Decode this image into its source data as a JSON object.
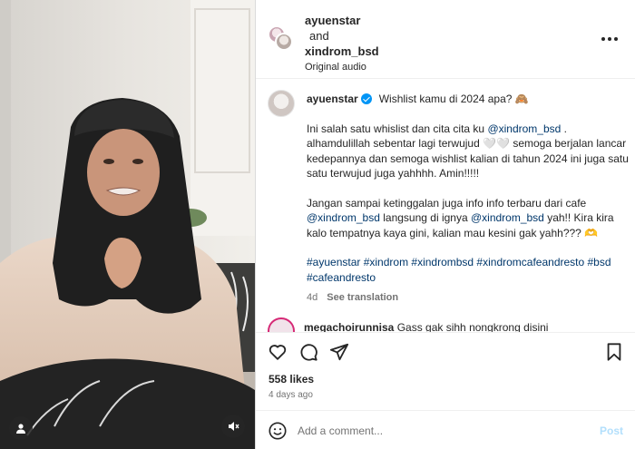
{
  "header": {
    "user1": "ayuenstar",
    "and": "and",
    "user2": "xindrom_bsd",
    "audio": "Original audio",
    "more_icon": "more-options-icon"
  },
  "caption": {
    "username": "ayuenstar",
    "title": "Wishlist kamu di 2024 apa? 🙈",
    "p1_a": "Ini salah satu whislist dan cita cita ku ",
    "p1_mention": "@xindrom_bsd",
    "p1_b": " . alhamdulillah sebentar lagi terwujud 🤍🤍 semoga berjalan lancar kedepannya dan semoga wishlist kalian di tahun 2024 ini juga satu satu terwujud juga yahhhh. Amin!!!!!",
    "p2_a": "Jangan sampai ketinggalan juga info info terbaru dari cafe ",
    "p2_mention1": "@xindrom_bsd",
    "p2_b": " langsung di ignya ",
    "p2_mention2": "@xindrom_bsd",
    "p2_c": " yah!! Kira kira kalo tempatnya kaya gini, kalian mau kesini gak yahh??? 🫶",
    "hashtags": "#ayuenstar #xindrom #xindrombsd #xindromcafeandresto #bsd #cafeandresto",
    "age": "4d",
    "see_translation": "See translation"
  },
  "comment_peek": {
    "username": "megachoirunnisa",
    "text": " Gass gak sihh nongkrong disini"
  },
  "actions": {
    "like_icon": "heart-icon",
    "comment_icon": "comment-icon",
    "share_icon": "paper-plane-icon",
    "save_icon": "bookmark-icon"
  },
  "likes": "558 likes",
  "posted_ago": "4 days ago",
  "add_comment": {
    "placeholder": "Add a comment...",
    "post_label": "Post"
  },
  "colors": {
    "link": "#00376b",
    "verified": "#0095f6",
    "post_disabled": "#b2dffc"
  }
}
